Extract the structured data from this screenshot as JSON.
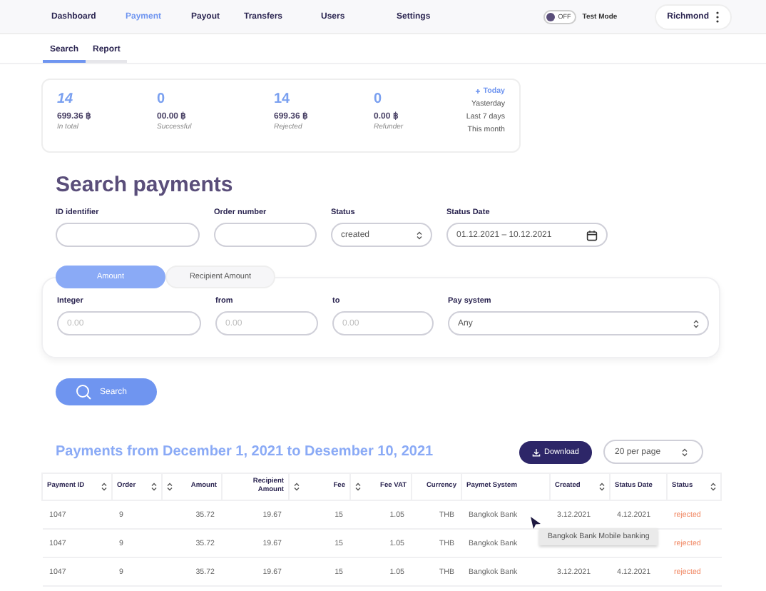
{
  "nav": {
    "items": [
      {
        "label": "Dashboard",
        "selected": false
      },
      {
        "label": "Payment",
        "selected": true
      },
      {
        "label": "Payout",
        "selected": false
      },
      {
        "label": "Transfers",
        "selected": false
      },
      {
        "label": "Users",
        "selected": false
      },
      {
        "label": "Settings",
        "selected": false
      }
    ],
    "test_mode": {
      "switch_text": "OFF",
      "label": "Test Mode",
      "on": false
    },
    "user": {
      "name": "Richmond"
    }
  },
  "subtabs": [
    {
      "label": "Search",
      "selected": true
    },
    {
      "label": "Report",
      "selected": false
    }
  ],
  "stats": [
    {
      "count": "14",
      "amount": "699.36 ฿",
      "label": "In total"
    },
    {
      "count": "0",
      "amount": "00.00 ฿",
      "label": "Successful"
    },
    {
      "count": "14",
      "amount": "699.36 ฿",
      "label": "Rejected"
    },
    {
      "count": "0",
      "amount": "0.00 ฿",
      "label": "Refunder"
    }
  ],
  "periods": [
    {
      "label": "Today",
      "selected": true
    },
    {
      "label": "Yasterday",
      "selected": false
    },
    {
      "label": "Last 7 days",
      "selected": false
    },
    {
      "label": "This month",
      "selected": false
    }
  ],
  "title": "Search payments",
  "filters": [
    {
      "label": "ID identifier",
      "kind": "input"
    },
    {
      "label": "Order number",
      "kind": "input"
    },
    {
      "label": "Status",
      "kind": "select",
      "value": "created"
    },
    {
      "label": "Status Date",
      "kind": "date",
      "value": "01.12.2021 – 10.12.2021"
    }
  ],
  "amount_tabs": [
    {
      "label": "Amount",
      "selected": true
    },
    {
      "label": "Recipient Amount",
      "selected": false
    }
  ],
  "amount_filters": [
    {
      "label": "Integer",
      "kind": "input",
      "placeholder": "0.00"
    },
    {
      "label": "from",
      "kind": "input",
      "placeholder": "0.00"
    },
    {
      "label": "to",
      "kind": "input",
      "placeholder": "0.00"
    },
    {
      "label": "Pay system",
      "kind": "select",
      "value": "Any"
    }
  ],
  "search_button": "Search",
  "results_title": "Payments from December 1, 2021 to Desember 10, 2021",
  "download_button": "Download",
  "per_page": "20 per page",
  "table": {
    "columns": [
      {
        "label": "Payment ID",
        "sortable": true
      },
      {
        "label": "Order",
        "sortable": true
      },
      {
        "label": "Amount",
        "sortable": true
      },
      {
        "label": "Recipient Amount",
        "sortable": false
      },
      {
        "label": "Fee",
        "sortable": true
      },
      {
        "label": "Fee VAT",
        "sortable": true
      },
      {
        "label": "Currency",
        "sortable": false
      },
      {
        "label": "Paymet System",
        "sortable": false
      },
      {
        "label": "Created",
        "sortable": true
      },
      {
        "label": "Status Date",
        "sortable": false
      },
      {
        "label": "Status",
        "sortable": true
      }
    ],
    "rows": [
      {
        "cells": [
          "1047",
          "9",
          "35.72",
          "19.67",
          "15",
          "1.05",
          "THB",
          "Bangkok Bank",
          "3.12.2021",
          "4.12.2021",
          "rejected"
        ]
      },
      {
        "cells": [
          "1047",
          "9",
          "35.72",
          "19.67",
          "15",
          "1.05",
          "THB",
          "Bangkok Bank",
          null,
          null,
          "rejected"
        ]
      },
      {
        "cells": [
          "1047",
          "9",
          "35.72",
          "19.67",
          "15",
          "1.05",
          "THB",
          "Bangkok Bank",
          "3.12.2021",
          "4.12.2021",
          "rejected"
        ]
      }
    ],
    "tooltip": "Bangkok Bank Mobile banking"
  }
}
